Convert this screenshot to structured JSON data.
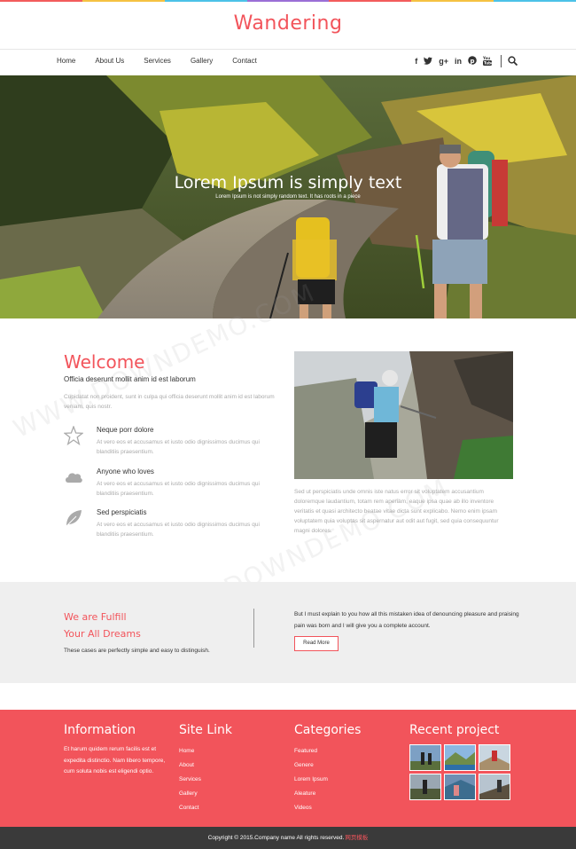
{
  "colors": {
    "accent": "#f2545b",
    "dark": "#3a3a3a",
    "band_bg": "#efefef",
    "strip": [
      "#f25c5c",
      "#f5c242",
      "#4cc2e8",
      "#9b6fd6",
      "#f25c5c",
      "#f5c242",
      "#4cc2e8"
    ]
  },
  "brand": {
    "logo": "Wandering"
  },
  "nav": {
    "items": [
      "Home",
      "About Us",
      "Services",
      "Gallery",
      "Contact"
    ],
    "social_icons": [
      {
        "name": "facebook-icon",
        "glyph": "f"
      },
      {
        "name": "twitter-icon",
        "glyph": "t"
      },
      {
        "name": "google-plus-icon",
        "glyph": "g+"
      },
      {
        "name": "linkedin-icon",
        "glyph": "in"
      },
      {
        "name": "pinterest-icon",
        "glyph": "p"
      },
      {
        "name": "youtube-icon",
        "glyph": "You"
      }
    ],
    "search_icon": "search-icon"
  },
  "hero": {
    "title": "Lorem Ipsum is simply text",
    "subtitle": "Lorem Ipsum is not simply random text. It has roots in a piece"
  },
  "welcome": {
    "title": "Welcome",
    "subtitle": "Officia deserunt mollit anim id est laborum",
    "text": "Cupidatat non proident, sunt in culpa qui officia deserunt mollit anim id est laborum veniam, quis nostr.",
    "features": [
      {
        "icon": "star-icon",
        "title": "Neque porr dolore",
        "text": "At vero eos et accusamus et iusto odio dignissimos ducimus qui blanditiis praesentium."
      },
      {
        "icon": "cloud-icon",
        "title": "Anyone who loves",
        "text": "At vero eos et accusamus et iusto odio dignissimos ducimus qui blanditiis praesentium."
      },
      {
        "icon": "leaf-icon",
        "title": "Sed perspiciatis",
        "text": "At vero eos et accusamus et iusto odio dignissimos ducimus qui blanditiis praesentium."
      }
    ],
    "photo_text": "Sed ut perspiciatis unde omnis iste natus error sit voluptatem accusantium doloremque laudantium, totam rem aperiam, eaque ipsa quae ab illo inventore veritatis et quasi architecto beatae vitae dicta sunt explicabo. Nemo enim ipsam voluptatem quia voluptas sit aspernatur aut odit aut fugit, sed quia consequuntur magni dolores."
  },
  "band": {
    "title_line1": "We are Fulfill",
    "title_line2": "Your All Dreams",
    "small": "These cases are perfectly simple and easy to distinguish.",
    "text": "But I must explain to you how all this mistaken idea of denouncing pleasure and praising pain was born and I will give you a complete account.",
    "button": "Read More"
  },
  "footer": {
    "information": {
      "title": "Information",
      "text": "Et harum quidem rerum facilis est et expedita distinctio. Nam libero tempore, cum soluta nobis est eligendi optio."
    },
    "site_link": {
      "title": "Site Link",
      "items": [
        "Home",
        "About",
        "Services",
        "Gallery",
        "Contact"
      ]
    },
    "categories": {
      "title": "Categories",
      "items": [
        "Featured",
        "Genere",
        "Lorem Ipsum",
        "Aleature",
        "Videos"
      ]
    },
    "recent": {
      "title": "Recent project"
    }
  },
  "copyright": {
    "text": "Copyright © 2015.Company name All rights reserved.",
    "highlight": "网页模板"
  },
  "watermark": "WWW.DOWNDEMO.COM"
}
